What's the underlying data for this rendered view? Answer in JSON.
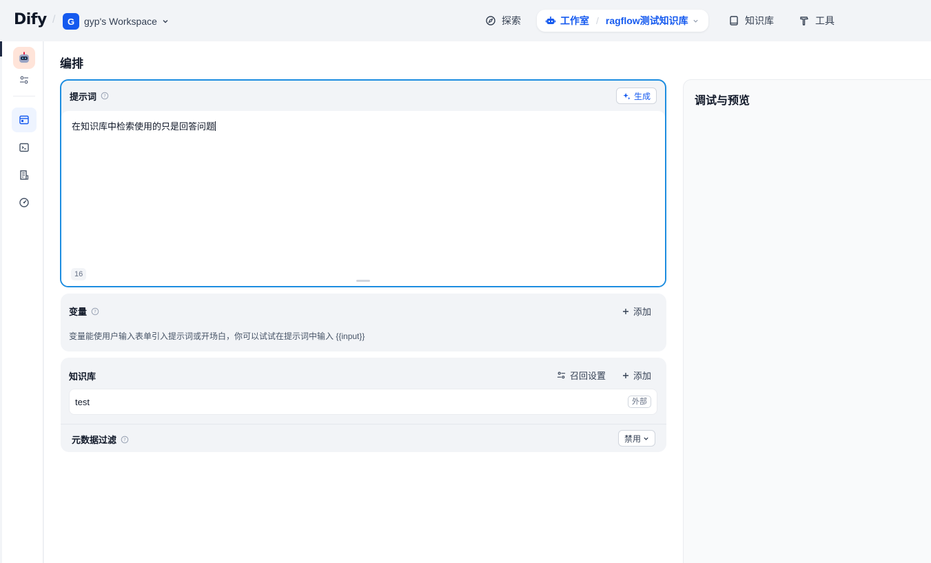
{
  "header": {
    "logo": "Dify",
    "workspace_initial": "G",
    "workspace_name": "gyp's Workspace",
    "nav": {
      "explore": "探索",
      "studio": "工作室",
      "app_name": "ragflow测试知识库",
      "knowledge": "知识库",
      "tools": "工具"
    }
  },
  "page": {
    "title": "编排"
  },
  "prompt": {
    "title": "提示词",
    "generate_label": "生成",
    "text": "在知识库中检索使用的只是回答问题",
    "char_count": "16"
  },
  "variables": {
    "title": "变量",
    "add_label": "添加",
    "description": "变量能使用户输入表单引入提示词或开场白，你可以试试在提示词中输入 {{input}}"
  },
  "knowledge": {
    "title": "知识库",
    "recall_label": "召回设置",
    "add_label": "添加",
    "items": [
      {
        "name": "test",
        "badge": "外部"
      }
    ],
    "metadata_filter_label": "元数据过滤",
    "metadata_filter_value": "禁用"
  },
  "preview": {
    "title": "调试与预览"
  },
  "colors": {
    "accent": "#155aef",
    "focus_border": "#1d8de0"
  }
}
